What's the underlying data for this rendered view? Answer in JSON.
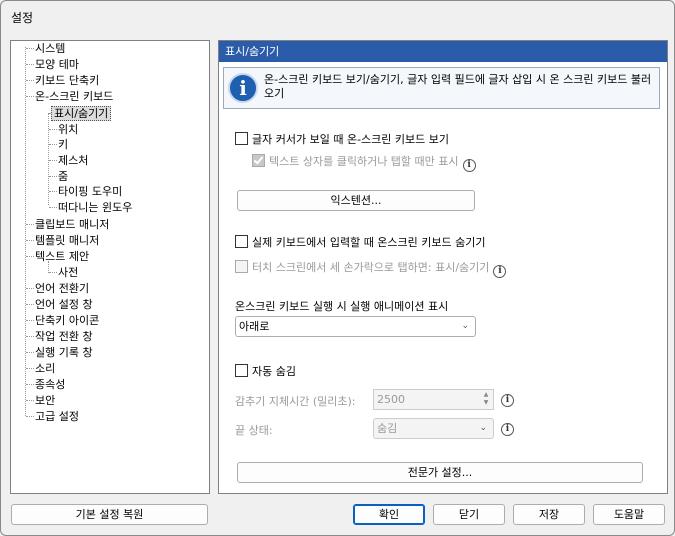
{
  "window": {
    "title": "설정"
  },
  "tree": {
    "items": [
      "시스템",
      "모양 테마",
      "키보드 단축키",
      "온-스크린 키보드",
      "표시/숨기기",
      "위치",
      "키",
      "제스처",
      "줌",
      "타이핑 도우미",
      "떠다니는 윈도우",
      "클립보드 매니저",
      "템플릿 매니저",
      "텍스트 제안",
      "사전",
      "언어 전환기",
      "언어 설정 창",
      "단축키 아이콘",
      "작업 전환 창",
      "실행 기록 창",
      "소리",
      "종속성",
      "보안",
      "고급 설정"
    ],
    "selected": "표시/숨기기"
  },
  "panel": {
    "header": "표시/숨기기",
    "info": "온-스크린 키보드 보기/숨기기, 글자 입력 필드에 글자 삽입 시 온 스크린 키보드 불러오기",
    "show_on_cursor": "글자 커서가 보일 때 온-스크린 키보드 보기",
    "show_on_textbox_click": "텍스트 상자를 클릭하거나 탭할 때만 표시",
    "extensions_button": "익스텐션...",
    "hide_on_physical": "실제 키보드에서 입력할 때 온스크린 키보드 숨기기",
    "three_finger_tap": "터치 스크린에서 세 손가락으로 탭하면: 표시/숨기기",
    "animation_label": "온스크린 키보드 실행 시 실행 애니메이션 표시",
    "animation_value": "아래로",
    "auto_hide": "자동 숨김",
    "hide_delay_label": "감추기 지체시간 (밀리초):",
    "hide_delay_value": "2500",
    "end_state_label": "끝 상태:",
    "end_state_value": "숨김",
    "expert_button": "전문가 설정..."
  },
  "footer": {
    "restore_defaults": "기본 설정 복원",
    "ok": "확인",
    "close": "닫기",
    "save": "저장",
    "help": "도움말"
  }
}
